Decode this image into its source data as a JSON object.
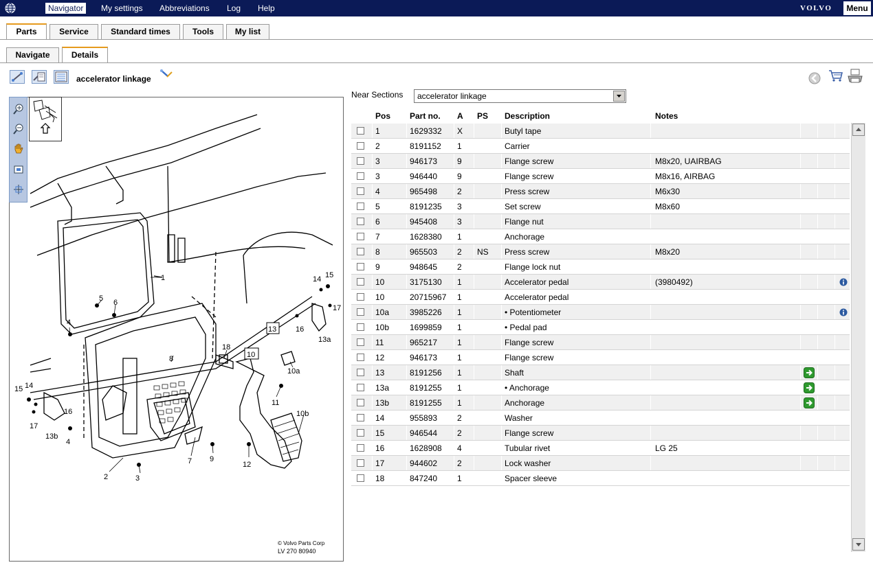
{
  "topbar": {
    "menu_items": [
      "Navigator",
      "My settings",
      "Abbreviations",
      "Log",
      "Help"
    ],
    "brand": "VOLVO",
    "menu_button": "Menu"
  },
  "main_tabs": [
    "Parts",
    "Service",
    "Standard times",
    "Tools",
    "My list"
  ],
  "sub_tabs": [
    "Navigate",
    "Details"
  ],
  "section_title": "accelerator linkage",
  "near_sections": {
    "label": "Near Sections",
    "value": "accelerator linkage"
  },
  "diagram": {
    "copyright": "© Volvo Parts Corp",
    "code": "LV 270 80940"
  },
  "table": {
    "headers": {
      "pos": "Pos",
      "part_no": "Part no.",
      "a": "A",
      "ps": "PS",
      "description": "Description",
      "notes": "Notes"
    },
    "rows": [
      {
        "pos": "1",
        "part": "1629332",
        "a": "X",
        "ps": "",
        "desc": "Butyl tape",
        "notes": ""
      },
      {
        "pos": "2",
        "part": "8191152",
        "a": "1",
        "ps": "",
        "desc": "Carrier",
        "notes": ""
      },
      {
        "pos": "3",
        "part": "946173",
        "a": "9",
        "ps": "",
        "desc": "Flange screw",
        "notes": "M8x20, UAIRBAG"
      },
      {
        "pos": "3",
        "part": "946440",
        "a": "9",
        "ps": "",
        "desc": "Flange screw",
        "notes": "M8x16, AIRBAG"
      },
      {
        "pos": "4",
        "part": "965498",
        "a": "2",
        "ps": "",
        "desc": "Press screw",
        "notes": "M6x30"
      },
      {
        "pos": "5",
        "part": "8191235",
        "a": "3",
        "ps": "",
        "desc": "Set screw",
        "notes": "M8x60"
      },
      {
        "pos": "6",
        "part": "945408",
        "a": "3",
        "ps": "",
        "desc": "Flange nut",
        "notes": ""
      },
      {
        "pos": "7",
        "part": "1628380",
        "a": "1",
        "ps": "",
        "desc": "Anchorage",
        "notes": ""
      },
      {
        "pos": "8",
        "part": "965503",
        "a": "2",
        "ps": "NS",
        "desc": "Press screw",
        "notes": "M8x20"
      },
      {
        "pos": "9",
        "part": "948645",
        "a": "2",
        "ps": "",
        "desc": "Flange lock nut",
        "notes": ""
      },
      {
        "pos": "10",
        "part": "3175130",
        "a": "1",
        "ps": "",
        "desc": "Accelerator pedal",
        "notes": "(3980492)",
        "info": true
      },
      {
        "pos": "10",
        "part": "20715967",
        "a": "1",
        "ps": "",
        "desc": "Accelerator pedal",
        "notes": ""
      },
      {
        "pos": "10a",
        "part": "3985226",
        "a": "1",
        "ps": "",
        "desc": "• Potentiometer",
        "notes": "",
        "info": true
      },
      {
        "pos": "10b",
        "part": "1699859",
        "a": "1",
        "ps": "",
        "desc": "• Pedal pad",
        "notes": ""
      },
      {
        "pos": "11",
        "part": "965217",
        "a": "1",
        "ps": "",
        "desc": "Flange screw",
        "notes": ""
      },
      {
        "pos": "12",
        "part": "946173",
        "a": "1",
        "ps": "",
        "desc": "Flange screw",
        "notes": ""
      },
      {
        "pos": "13",
        "part": "8191256",
        "a": "1",
        "ps": "",
        "desc": "Shaft",
        "notes": "",
        "go": true
      },
      {
        "pos": "13a",
        "part": "8191255",
        "a": "1",
        "ps": "",
        "desc": "• Anchorage",
        "notes": "",
        "go": true
      },
      {
        "pos": "13b",
        "part": "8191255",
        "a": "1",
        "ps": "",
        "desc": "Anchorage",
        "notes": "",
        "go": true
      },
      {
        "pos": "14",
        "part": "955893",
        "a": "2",
        "ps": "",
        "desc": "Washer",
        "notes": ""
      },
      {
        "pos": "15",
        "part": "946544",
        "a": "2",
        "ps": "",
        "desc": "Flange screw",
        "notes": ""
      },
      {
        "pos": "16",
        "part": "1628908",
        "a": "4",
        "ps": "",
        "desc": "Tubular rivet",
        "notes": "LG 25"
      },
      {
        "pos": "17",
        "part": "944602",
        "a": "2",
        "ps": "",
        "desc": "Lock washer",
        "notes": ""
      },
      {
        "pos": "18",
        "part": "847240",
        "a": "1",
        "ps": "",
        "desc": "Spacer sleeve",
        "notes": ""
      }
    ]
  },
  "callouts": [
    "1",
    "2",
    "3",
    "4",
    "4",
    "5",
    "6",
    "7",
    "8",
    "9",
    "10",
    "10a",
    "10b",
    "11",
    "12",
    "13",
    "13a",
    "13b",
    "14",
    "14",
    "15",
    "15",
    "16",
    "16",
    "17",
    "17",
    "18"
  ],
  "colors": {
    "topbar": "#0b1a57",
    "tab_accent": "#e69a1c",
    "go_green": "#2f9a2f",
    "info_blue": "#2c5aa0"
  },
  "icons": [
    "globe-icon",
    "linkage-view-icon",
    "detail-view-icon",
    "list-view-icon",
    "pick-tool-icon",
    "zoom-in-icon",
    "zoom-out-icon",
    "pan-hand-icon",
    "fit-icon",
    "reset-view-icon",
    "back-icon",
    "cart-icon",
    "print-icon"
  ]
}
